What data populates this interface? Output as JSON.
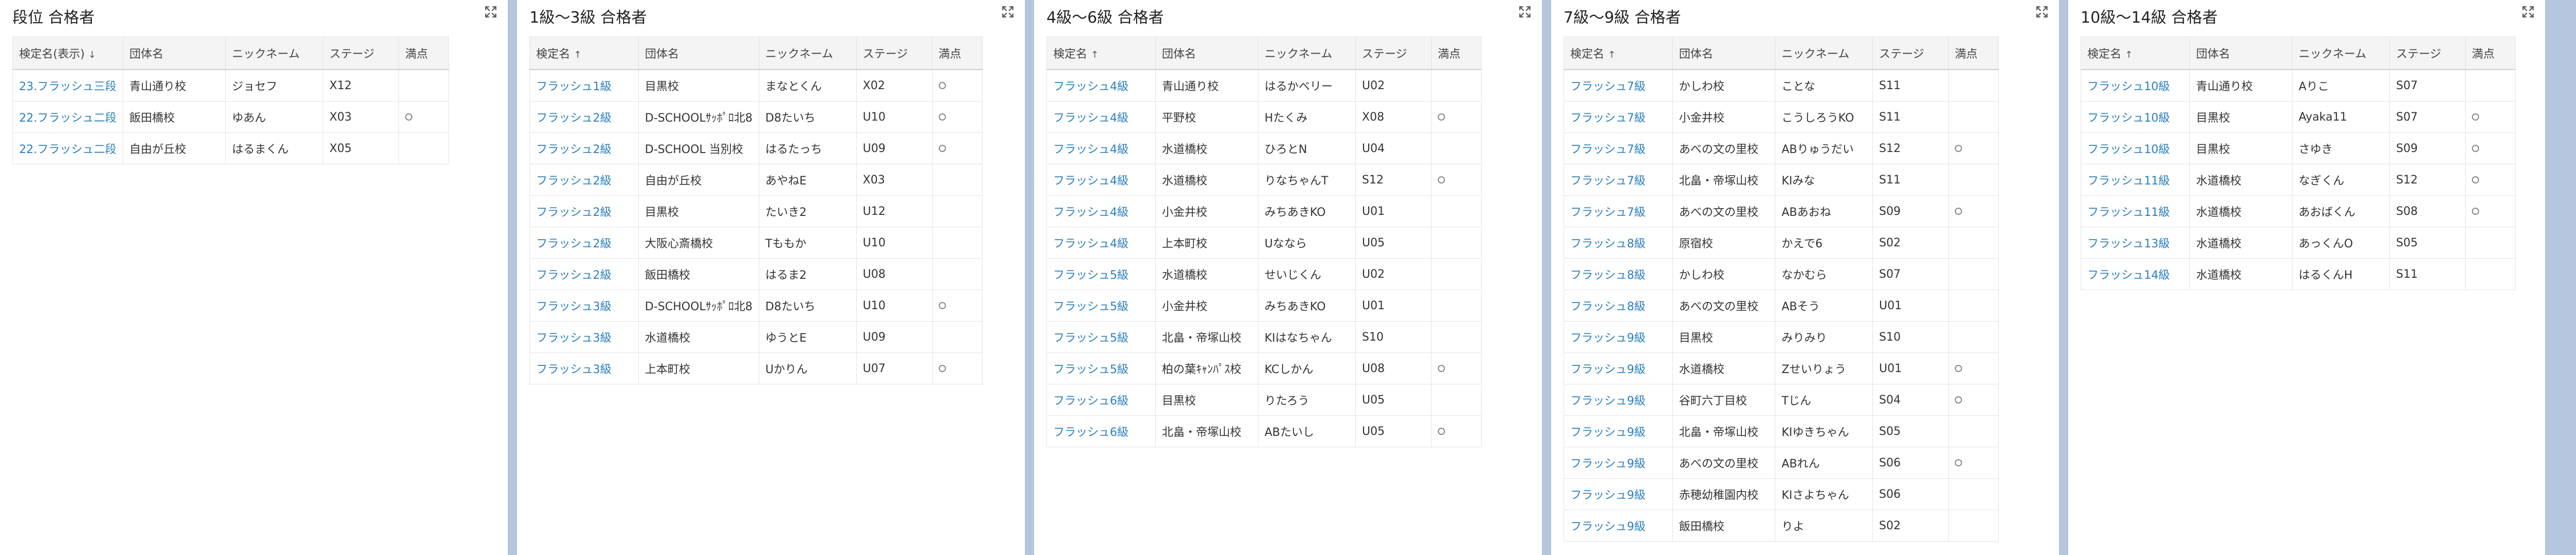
{
  "headers": {
    "name_display": "検定名(表示)",
    "name": "検定名",
    "team": "団体名",
    "nick": "ニックネーム",
    "stage": "ステージ",
    "full": "満点"
  },
  "sort": {
    "up": "↑",
    "down": "↓"
  },
  "panels": [
    {
      "title": "段位 合格者",
      "name_header": "name_display",
      "sort_dir": "down",
      "rows": [
        {
          "name": "23.フラッシュ三段",
          "team": "青山通り校",
          "nick": "ジョセフ",
          "stage": "X12",
          "full": ""
        },
        {
          "name": "22.フラッシュ二段",
          "team": "飯田橋校",
          "nick": "ゆあん",
          "stage": "X03",
          "full": "○"
        },
        {
          "name": "22.フラッシュ二段",
          "team": "自由が丘校",
          "nick": "はるまくん",
          "stage": "X05",
          "full": ""
        }
      ]
    },
    {
      "title": "1級～3級 合格者",
      "name_header": "name",
      "sort_dir": "up",
      "rows": [
        {
          "name": "フラッシュ1級",
          "team": "目黒校",
          "nick": "まなとくん",
          "stage": "X02",
          "full": "○"
        },
        {
          "name": "フラッシュ2級",
          "team": "D-SCHOOLｻｯﾎﾟﾛ北8",
          "nick": "D8たいち",
          "stage": "U10",
          "full": "○"
        },
        {
          "name": "フラッシュ2級",
          "team": "D-SCHOOL 当別校",
          "nick": "はるたっち",
          "stage": "U09",
          "full": "○"
        },
        {
          "name": "フラッシュ2級",
          "team": "自由が丘校",
          "nick": "あやねE",
          "stage": "X03",
          "full": ""
        },
        {
          "name": "フラッシュ2級",
          "team": "目黒校",
          "nick": "たいき2",
          "stage": "U12",
          "full": ""
        },
        {
          "name": "フラッシュ2級",
          "team": "大阪心斎橋校",
          "nick": "Tももか",
          "stage": "U10",
          "full": ""
        },
        {
          "name": "フラッシュ2級",
          "team": "飯田橋校",
          "nick": "はるま2",
          "stage": "U08",
          "full": ""
        },
        {
          "name": "フラッシュ3級",
          "team": "D-SCHOOLｻｯﾎﾟﾛ北8",
          "nick": "D8たいち",
          "stage": "U10",
          "full": "○"
        },
        {
          "name": "フラッシュ3級",
          "team": "水道橋校",
          "nick": "ゆうとE",
          "stage": "U09",
          "full": ""
        },
        {
          "name": "フラッシュ3級",
          "team": "上本町校",
          "nick": "Uかりん",
          "stage": "U07",
          "full": "○"
        }
      ]
    },
    {
      "title": "4級～6級 合格者",
      "name_header": "name",
      "sort_dir": "up",
      "rows": [
        {
          "name": "フラッシュ4級",
          "team": "青山通り校",
          "nick": "はるかベリー",
          "stage": "U02",
          "full": ""
        },
        {
          "name": "フラッシュ4級",
          "team": "平野校",
          "nick": "Hたくみ",
          "stage": "X08",
          "full": "○"
        },
        {
          "name": "フラッシュ4級",
          "team": "水道橋校",
          "nick": "ひろとN",
          "stage": "U04",
          "full": ""
        },
        {
          "name": "フラッシュ4級",
          "team": "水道橋校",
          "nick": "りなちゃんT",
          "stage": "S12",
          "full": "○"
        },
        {
          "name": "フラッシュ4級",
          "team": "小金井校",
          "nick": "みちあきKO",
          "stage": "U01",
          "full": ""
        },
        {
          "name": "フラッシュ4級",
          "team": "上本町校",
          "nick": "Uななら",
          "stage": "U05",
          "full": ""
        },
        {
          "name": "フラッシュ5級",
          "team": "水道橋校",
          "nick": "せいじくん",
          "stage": "U02",
          "full": ""
        },
        {
          "name": "フラッシュ5級",
          "team": "小金井校",
          "nick": "みちあきKO",
          "stage": "U01",
          "full": ""
        },
        {
          "name": "フラッシュ5級",
          "team": "北畠・帝塚山校",
          "nick": "KIはなちゃん",
          "stage": "S10",
          "full": ""
        },
        {
          "name": "フラッシュ5級",
          "team": "柏の葉ｷｬﾝﾊﾟｽ校",
          "nick": "KCしかん",
          "stage": "U08",
          "full": "○"
        },
        {
          "name": "フラッシュ6級",
          "team": "目黒校",
          "nick": "りたろう",
          "stage": "U05",
          "full": ""
        },
        {
          "name": "フラッシュ6級",
          "team": "北畠・帝塚山校",
          "nick": "ABたいし",
          "stage": "U05",
          "full": "○"
        }
      ]
    },
    {
      "title": "7級～9級 合格者",
      "name_header": "name",
      "sort_dir": "up",
      "rows": [
        {
          "name": "フラッシュ7級",
          "team": "かしわ校",
          "nick": "ことな",
          "stage": "S11",
          "full": ""
        },
        {
          "name": "フラッシュ7級",
          "team": "小金井校",
          "nick": "こうしろうKO",
          "stage": "S11",
          "full": ""
        },
        {
          "name": "フラッシュ7級",
          "team": "あべの文の里校",
          "nick": "ABりゅうだい",
          "stage": "S12",
          "full": "○"
        },
        {
          "name": "フラッシュ7級",
          "team": "北畠・帝塚山校",
          "nick": "KIみな",
          "stage": "S11",
          "full": ""
        },
        {
          "name": "フラッシュ7級",
          "team": "あべの文の里校",
          "nick": "ABあおね",
          "stage": "S09",
          "full": "○"
        },
        {
          "name": "フラッシュ8級",
          "team": "原宿校",
          "nick": "かえで6",
          "stage": "S02",
          "full": ""
        },
        {
          "name": "フラッシュ8級",
          "team": "かしわ校",
          "nick": "なかむら",
          "stage": "S07",
          "full": ""
        },
        {
          "name": "フラッシュ8級",
          "team": "あべの文の里校",
          "nick": "ABそう",
          "stage": "U01",
          "full": ""
        },
        {
          "name": "フラッシュ9級",
          "team": "目黒校",
          "nick": "みりみり",
          "stage": "S10",
          "full": ""
        },
        {
          "name": "フラッシュ9級",
          "team": "水道橋校",
          "nick": "Zせいりょう",
          "stage": "U01",
          "full": "○"
        },
        {
          "name": "フラッシュ9級",
          "team": "谷町六丁目校",
          "nick": "Tじん",
          "stage": "S04",
          "full": "○"
        },
        {
          "name": "フラッシュ9級",
          "team": "北畠・帝塚山校",
          "nick": "KIゆきちゃん",
          "stage": "S05",
          "full": ""
        },
        {
          "name": "フラッシュ9級",
          "team": "あべの文の里校",
          "nick": "ABれん",
          "stage": "S06",
          "full": "○"
        },
        {
          "name": "フラッシュ9級",
          "team": "赤穂幼稚園内校",
          "nick": "KIさよちゃん",
          "stage": "S06",
          "full": ""
        },
        {
          "name": "フラッシュ9級",
          "team": "飯田橋校",
          "nick": "りよ",
          "stage": "S02",
          "full": ""
        }
      ]
    },
    {
      "title": "10級～14級 合格者",
      "name_header": "name",
      "sort_dir": "up",
      "rows": [
        {
          "name": "フラッシュ10級",
          "team": "青山通り校",
          "nick": "Aりこ",
          "stage": "S07",
          "full": ""
        },
        {
          "name": "フラッシュ10級",
          "team": "目黒校",
          "nick": "Ayaka11",
          "stage": "S07",
          "full": "○"
        },
        {
          "name": "フラッシュ10級",
          "team": "目黒校",
          "nick": "さゆき",
          "stage": "S09",
          "full": "○"
        },
        {
          "name": "フラッシュ11級",
          "team": "水道橋校",
          "nick": "なぎくん",
          "stage": "S12",
          "full": "○"
        },
        {
          "name": "フラッシュ11級",
          "team": "水道橋校",
          "nick": "あおばくん",
          "stage": "S08",
          "full": "○"
        },
        {
          "name": "フラッシュ13級",
          "team": "水道橋校",
          "nick": "あっくんO",
          "stage": "S05",
          "full": ""
        },
        {
          "name": "フラッシュ14級",
          "team": "水道橋校",
          "nick": "はるくんH",
          "stage": "S11",
          "full": ""
        }
      ]
    }
  ]
}
